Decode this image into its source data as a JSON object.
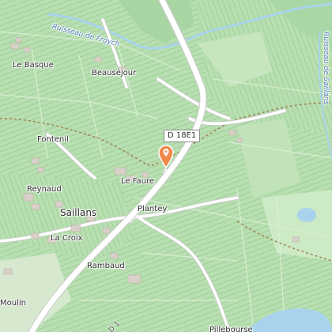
{
  "map": {
    "labels": {
      "stream_froych": "Ruisseau de Froych",
      "stream_right": "Ruisseau de Saillans",
      "le_basque": "Le Basque",
      "beausejour": "Beauséjour",
      "fontenil": "Fontenil",
      "le_faure": "Le Faure",
      "reynaud": "Reynaud",
      "saillans": "Saillans",
      "plantey": "Plantey",
      "la_croix": "La Croix",
      "rambaud": "Rambaud",
      "moulin": "Moulin",
      "pillebourse": "Pillebourse",
      "road_bottom": "D 1"
    },
    "road_shield": "D 18E1",
    "marker_icon": "map-pin-icon",
    "colors": {
      "background": "#b7ddb0",
      "vineyard_stripe": "#9fcf98",
      "road": "#ffffff",
      "road_casing": "#c9c9c9",
      "water": "#a9d3ec",
      "marker": "#f08a4b",
      "boundary": "#a0824f"
    }
  }
}
